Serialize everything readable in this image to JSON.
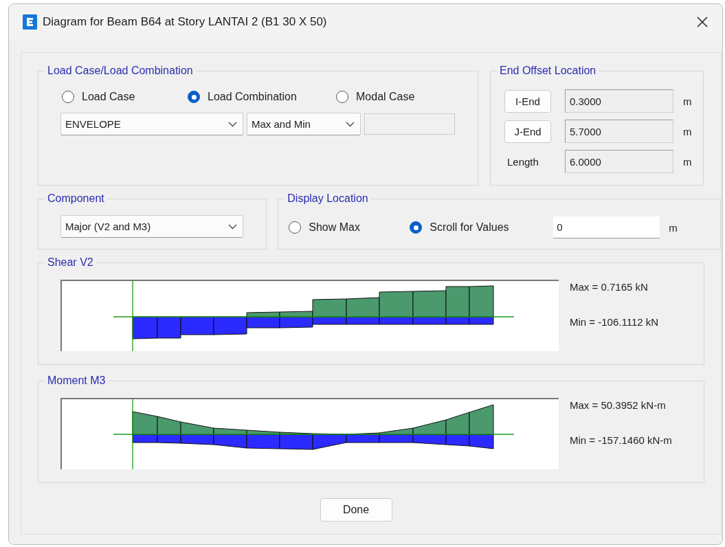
{
  "window": {
    "title": "Diagram for Beam B64 at Story LANTAI 2 (B1 30 X 50)"
  },
  "load_case_group": {
    "title": "Load Case/Load Combination",
    "options": [
      {
        "label": "Load Case",
        "selected": false
      },
      {
        "label": "Load Combination",
        "selected": true
      },
      {
        "label": "Modal Case",
        "selected": false
      }
    ],
    "combination": "ENVELOPE",
    "mode": "Max and Min"
  },
  "end_offset": {
    "title": "End Offset Location",
    "rows": [
      {
        "kind": "button",
        "label": "I-End",
        "value": "0.3000",
        "unit": "m"
      },
      {
        "kind": "button",
        "label": "J-End",
        "value": "5.7000",
        "unit": "m"
      },
      {
        "kind": "label",
        "label": "Length",
        "value": "6.0000",
        "unit": "m"
      }
    ]
  },
  "component": {
    "title": "Component",
    "value": "Major (V2 and M3)"
  },
  "display_location": {
    "title": "Display Location",
    "options": [
      {
        "label": "Show Max",
        "selected": false
      },
      {
        "label": "Scroll for Values",
        "selected": true
      }
    ],
    "value": "0",
    "unit": "m"
  },
  "diagrams": [
    {
      "kind": "shear",
      "title": "Shear V2",
      "max": "Max = 0.7165 kN",
      "min": "Min = -106.1112 kN"
    },
    {
      "kind": "moment",
      "title": "Moment M3",
      "max": "Max = 50.3952 kN-m",
      "min": "Min = -157.1460 kN-m"
    }
  ],
  "buttons": [
    {
      "label": "Done"
    }
  ]
}
